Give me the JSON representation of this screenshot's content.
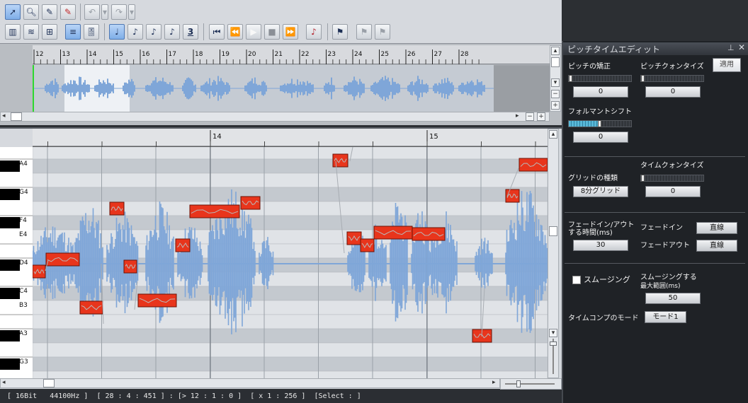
{
  "toolbar": {
    "row1": [
      "select-tool",
      "zoom-tool",
      "pencil-tool",
      "eraser-tool",
      "undo",
      "redo"
    ],
    "row2_transport": [
      "go-start",
      "rewind",
      "play",
      "stop",
      "fast-forward"
    ],
    "note_lengths": [
      "♩",
      "♪",
      "♪",
      "♪",
      "3"
    ]
  },
  "overview": {
    "ruler_labels": [
      "12",
      "13",
      "14",
      "15",
      "16",
      "17",
      "18",
      "19",
      "20",
      "21",
      "22",
      "23",
      "24",
      "25",
      "26",
      "27",
      "28"
    ]
  },
  "editor": {
    "ruler_labels": [
      "14",
      "15"
    ],
    "key_labels": [
      "A4",
      "G4",
      "F4",
      "E4",
      "D4",
      "C4",
      "B3",
      "A3",
      "G3"
    ]
  },
  "status": {
    "format": "[ 16Bit   44100Hz ]",
    "position": "[ 28 : 4 : 451 ] : [> 12 : 1 : 0 ]",
    "zoom": "[ x 1 : 256 ]",
    "select": "[Select : ]"
  },
  "panel": {
    "title": "ピッチタイムエディット",
    "pin_icon": "pin-icon",
    "close_icon": "close-icon",
    "apply_button": "適用",
    "pitch_correction_label": "ピッチの矯正",
    "pitch_correction_value": "0",
    "pitch_quantize_label": "ピッチクォンタイズ",
    "pitch_quantize_value": "0",
    "formant_shift_label": "フォルマントシフト",
    "formant_shift_value": "0",
    "formant_shift_level": 0.5,
    "grid_type_label": "グリッドの種類",
    "grid_type_value": "8分グリッド",
    "time_quantize_label": "タイムクォンタイズ",
    "time_quantize_value": "0",
    "fade_time_label_1": "フェードイン/アウト",
    "fade_time_label_2": "する時間(ms)",
    "fade_time_value": "30",
    "fade_in_label": "フェードイン",
    "fade_in_value": "直線",
    "fade_out_label": "フェードアウト",
    "fade_out_value": "直線",
    "smoothing_label": "スムージング",
    "smoothing_max_label_1": "スムージングする",
    "smoothing_max_label_2": "最大範囲(ms)",
    "smoothing_max_value": "50",
    "timecomp_mode_label": "タイムコンプのモード",
    "timecomp_mode_value": "モード1"
  },
  "colors": {
    "note_fill": "#e8351c",
    "waveform": "#7fa6d8",
    "panel_bg": "#1f2226"
  }
}
